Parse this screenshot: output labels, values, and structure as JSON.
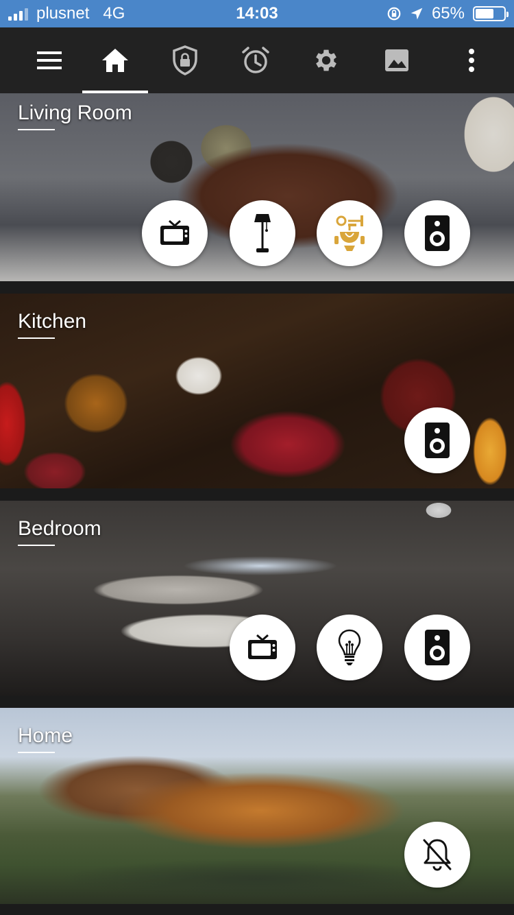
{
  "status_bar": {
    "carrier": "plusnet",
    "network": "4G",
    "time": "14:03",
    "battery": "65%",
    "battery_level": 0.65
  },
  "toolbar": {
    "items": [
      {
        "icon": "menu-icon"
      },
      {
        "icon": "home-icon",
        "active": true
      },
      {
        "icon": "shield-lock-icon"
      },
      {
        "icon": "alarm-clock-icon"
      },
      {
        "icon": "gear-icon"
      },
      {
        "icon": "image-icon"
      },
      {
        "icon": "more-vertical-icon"
      }
    ]
  },
  "rooms": [
    {
      "title": "Living Room",
      "devices": [
        "tv-icon",
        "floor-lamp-icon",
        "chandelier-icon",
        "speaker-icon"
      ]
    },
    {
      "title": "Kitchen",
      "devices": [
        "speaker-icon"
      ]
    },
    {
      "title": "Bedroom",
      "devices": [
        "tv-icon",
        "lightbulb-icon",
        "speaker-icon"
      ]
    },
    {
      "title": "Home",
      "devices": [
        "bell-off-icon"
      ]
    }
  ],
  "colors": {
    "status_bar": "#4a86c9",
    "toolbar": "#222222",
    "accent_gold": "#d9a53a"
  }
}
